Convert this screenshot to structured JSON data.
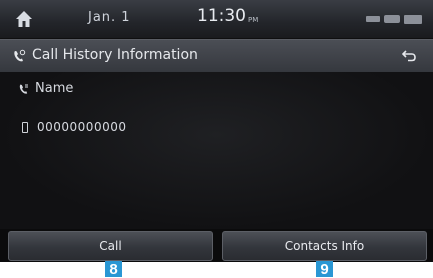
{
  "status_bar": {
    "date": "Jan. 1",
    "time": "11:30",
    "ampm": "PM",
    "icons": [
      "home-icon",
      "battery-icon",
      "signal-icon",
      "bluetooth-icon"
    ]
  },
  "title_bar": {
    "title": "Call History Information",
    "icon": "call-history-icon",
    "back_icon": "back-arrow-icon"
  },
  "contact": {
    "name": "Name",
    "number": "00000000000"
  },
  "buttons": {
    "call": "Call",
    "contacts_info": "Contacts Info"
  },
  "callouts": {
    "call": "8",
    "contacts_info": "9"
  },
  "colors": {
    "background": "#0f0f10",
    "bar": "#3a3d44",
    "callout": "#2a97d4",
    "text": "#e6e8ec"
  }
}
